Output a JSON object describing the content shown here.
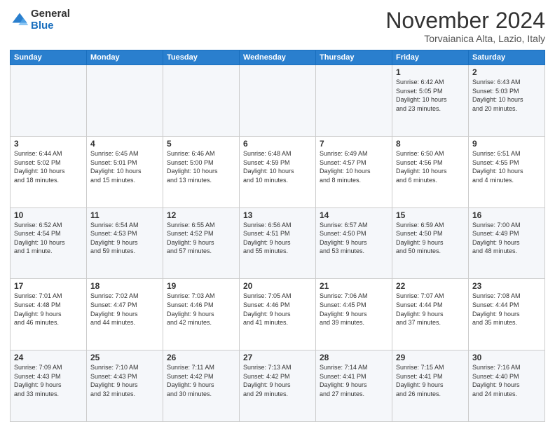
{
  "header": {
    "logo_general": "General",
    "logo_blue": "Blue",
    "month": "November 2024",
    "location": "Torvaianica Alta, Lazio, Italy"
  },
  "days_of_week": [
    "Sunday",
    "Monday",
    "Tuesday",
    "Wednesday",
    "Thursday",
    "Friday",
    "Saturday"
  ],
  "weeks": [
    [
      {
        "day": "",
        "info": ""
      },
      {
        "day": "",
        "info": ""
      },
      {
        "day": "",
        "info": ""
      },
      {
        "day": "",
        "info": ""
      },
      {
        "day": "",
        "info": ""
      },
      {
        "day": "1",
        "info": "Sunrise: 6:42 AM\nSunset: 5:05 PM\nDaylight: 10 hours\nand 23 minutes."
      },
      {
        "day": "2",
        "info": "Sunrise: 6:43 AM\nSunset: 5:03 PM\nDaylight: 10 hours\nand 20 minutes."
      }
    ],
    [
      {
        "day": "3",
        "info": "Sunrise: 6:44 AM\nSunset: 5:02 PM\nDaylight: 10 hours\nand 18 minutes."
      },
      {
        "day": "4",
        "info": "Sunrise: 6:45 AM\nSunset: 5:01 PM\nDaylight: 10 hours\nand 15 minutes."
      },
      {
        "day": "5",
        "info": "Sunrise: 6:46 AM\nSunset: 5:00 PM\nDaylight: 10 hours\nand 13 minutes."
      },
      {
        "day": "6",
        "info": "Sunrise: 6:48 AM\nSunset: 4:59 PM\nDaylight: 10 hours\nand 10 minutes."
      },
      {
        "day": "7",
        "info": "Sunrise: 6:49 AM\nSunset: 4:57 PM\nDaylight: 10 hours\nand 8 minutes."
      },
      {
        "day": "8",
        "info": "Sunrise: 6:50 AM\nSunset: 4:56 PM\nDaylight: 10 hours\nand 6 minutes."
      },
      {
        "day": "9",
        "info": "Sunrise: 6:51 AM\nSunset: 4:55 PM\nDaylight: 10 hours\nand 4 minutes."
      }
    ],
    [
      {
        "day": "10",
        "info": "Sunrise: 6:52 AM\nSunset: 4:54 PM\nDaylight: 10 hours\nand 1 minute."
      },
      {
        "day": "11",
        "info": "Sunrise: 6:54 AM\nSunset: 4:53 PM\nDaylight: 9 hours\nand 59 minutes."
      },
      {
        "day": "12",
        "info": "Sunrise: 6:55 AM\nSunset: 4:52 PM\nDaylight: 9 hours\nand 57 minutes."
      },
      {
        "day": "13",
        "info": "Sunrise: 6:56 AM\nSunset: 4:51 PM\nDaylight: 9 hours\nand 55 minutes."
      },
      {
        "day": "14",
        "info": "Sunrise: 6:57 AM\nSunset: 4:50 PM\nDaylight: 9 hours\nand 53 minutes."
      },
      {
        "day": "15",
        "info": "Sunrise: 6:59 AM\nSunset: 4:50 PM\nDaylight: 9 hours\nand 50 minutes."
      },
      {
        "day": "16",
        "info": "Sunrise: 7:00 AM\nSunset: 4:49 PM\nDaylight: 9 hours\nand 48 minutes."
      }
    ],
    [
      {
        "day": "17",
        "info": "Sunrise: 7:01 AM\nSunset: 4:48 PM\nDaylight: 9 hours\nand 46 minutes."
      },
      {
        "day": "18",
        "info": "Sunrise: 7:02 AM\nSunset: 4:47 PM\nDaylight: 9 hours\nand 44 minutes."
      },
      {
        "day": "19",
        "info": "Sunrise: 7:03 AM\nSunset: 4:46 PM\nDaylight: 9 hours\nand 42 minutes."
      },
      {
        "day": "20",
        "info": "Sunrise: 7:05 AM\nSunset: 4:46 PM\nDaylight: 9 hours\nand 41 minutes."
      },
      {
        "day": "21",
        "info": "Sunrise: 7:06 AM\nSunset: 4:45 PM\nDaylight: 9 hours\nand 39 minutes."
      },
      {
        "day": "22",
        "info": "Sunrise: 7:07 AM\nSunset: 4:44 PM\nDaylight: 9 hours\nand 37 minutes."
      },
      {
        "day": "23",
        "info": "Sunrise: 7:08 AM\nSunset: 4:44 PM\nDaylight: 9 hours\nand 35 minutes."
      }
    ],
    [
      {
        "day": "24",
        "info": "Sunrise: 7:09 AM\nSunset: 4:43 PM\nDaylight: 9 hours\nand 33 minutes."
      },
      {
        "day": "25",
        "info": "Sunrise: 7:10 AM\nSunset: 4:43 PM\nDaylight: 9 hours\nand 32 minutes."
      },
      {
        "day": "26",
        "info": "Sunrise: 7:11 AM\nSunset: 4:42 PM\nDaylight: 9 hours\nand 30 minutes."
      },
      {
        "day": "27",
        "info": "Sunrise: 7:13 AM\nSunset: 4:42 PM\nDaylight: 9 hours\nand 29 minutes."
      },
      {
        "day": "28",
        "info": "Sunrise: 7:14 AM\nSunset: 4:41 PM\nDaylight: 9 hours\nand 27 minutes."
      },
      {
        "day": "29",
        "info": "Sunrise: 7:15 AM\nSunset: 4:41 PM\nDaylight: 9 hours\nand 26 minutes."
      },
      {
        "day": "30",
        "info": "Sunrise: 7:16 AM\nSunset: 4:40 PM\nDaylight: 9 hours\nand 24 minutes."
      }
    ]
  ]
}
